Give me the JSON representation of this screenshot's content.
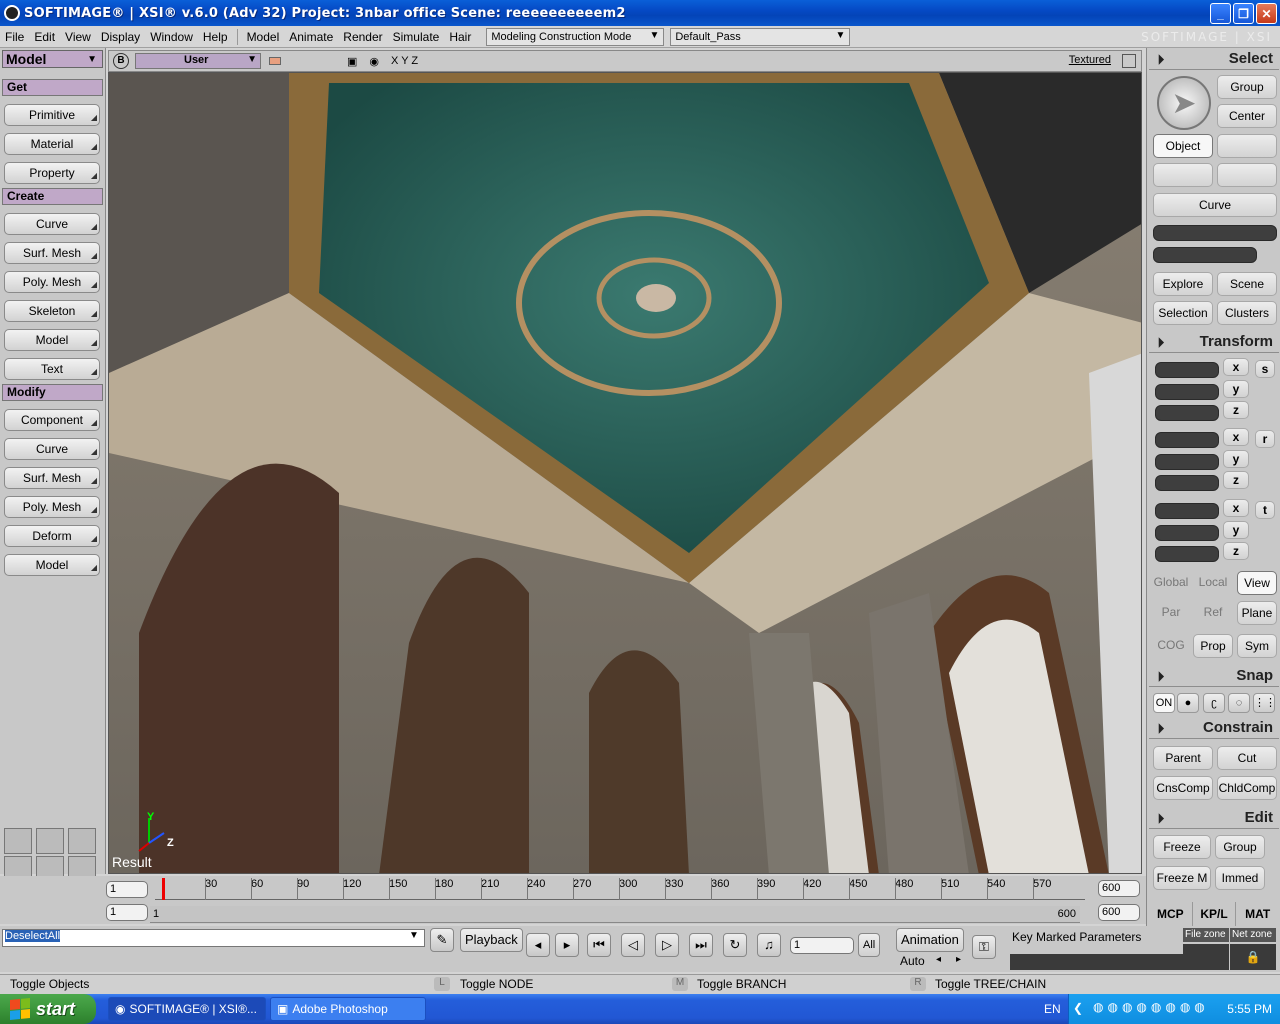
{
  "window": {
    "title": "SOFTIMAGE® | XSI® v.6.0 (Adv 32) Project: 3nbar office    Scene: reeeeeeeeeem2",
    "brand": "SOFTIMAGE | XSI"
  },
  "menu": {
    "items": [
      "File",
      "Edit",
      "View",
      "Display",
      "Window",
      "Help",
      "Model",
      "Animate",
      "Render",
      "Simulate",
      "Hair"
    ],
    "mode": "Modeling Construction Mode",
    "pass": "Default_Pass"
  },
  "left_panel": {
    "module": "Model",
    "sections": {
      "get": "Get",
      "create": "Create",
      "modify": "Modify"
    },
    "get_buttons": [
      "Primitive",
      "Material",
      "Property"
    ],
    "create_buttons": [
      "Curve",
      "Surf. Mesh",
      "Poly. Mesh",
      "Skeleton",
      "Model",
      "Text"
    ],
    "modify_buttons": [
      "Component",
      "Curve",
      "Surf. Mesh",
      "Poly. Mesh",
      "Deform",
      "Model"
    ]
  },
  "viewport": {
    "b_label": "B",
    "camera": "User",
    "axes": "X Y Z",
    "display_mode": "Textured",
    "result_label": "Result",
    "axis_y": "Y",
    "axis_z": "Z"
  },
  "right_panel": {
    "select_header": "Select",
    "group": "Group",
    "center": "Center",
    "object": "Object",
    "curve": "Curve",
    "explore": "Explore",
    "scene": "Scene",
    "selection": "Selection",
    "clusters": "Clusters",
    "transform_header": "Transform",
    "axes": [
      "x",
      "y",
      "z"
    ],
    "side_s": "s",
    "side_r": "r",
    "side_t": "t",
    "global": "Global",
    "local": "Local",
    "view": "View",
    "par": "Par",
    "ref": "Ref",
    "plane": "Plane",
    "cog": "COG",
    "prop": "Prop",
    "sym": "Sym",
    "snap_header": "Snap",
    "snap_on": "ON",
    "constrain_header": "Constrain",
    "parent": "Parent",
    "cut": "Cut",
    "cnscomp": "CnsComp",
    "chldcomp": "ChldComp",
    "edit_header": "Edit",
    "freeze": "Freeze",
    "edit_group": "Group",
    "freeze_m": "Freeze M",
    "immed": "Immed",
    "tabs": [
      "MCP",
      "KP/L",
      "MAT"
    ]
  },
  "timeline": {
    "start_field": "1",
    "end_field": "600",
    "range_start": "1",
    "range_start_label": "1",
    "range_end_label": "600",
    "range_end_field": "600",
    "ticks": [
      "30",
      "60",
      "90",
      "120",
      "150",
      "180",
      "210",
      "240",
      "270",
      "300",
      "330",
      "360",
      "390",
      "420",
      "450",
      "480",
      "510",
      "540",
      "570"
    ]
  },
  "controls": {
    "command": "DeselectAll",
    "playback": "Playback",
    "frame": "1",
    "all": "All",
    "animation": "Animation",
    "auto": "Auto",
    "key_marked": "Key Marked Parameters",
    "file_zone": "File zone",
    "net_zone": "Net zone"
  },
  "status": {
    "toggle_objects": "Toggle Objects",
    "key_l": "L",
    "toggle_node": "Toggle NODE",
    "key_m": "M",
    "toggle_branch": "Toggle BRANCH",
    "key_r": "R",
    "toggle_tree": "Toggle TREE/CHAIN"
  },
  "taskbar": {
    "start": "start",
    "tasks": [
      "SOFTIMAGE® | XSI®...",
      "Adobe Photoshop"
    ],
    "lang": "EN",
    "clock": "5:55 PM"
  }
}
